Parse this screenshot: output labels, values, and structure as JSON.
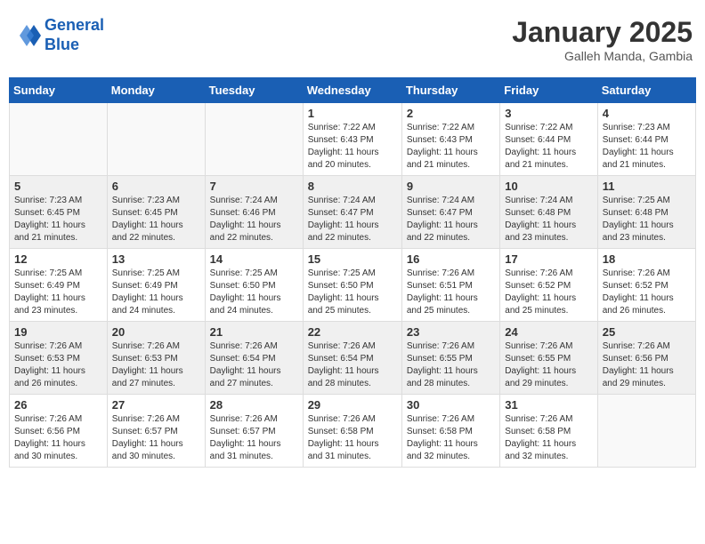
{
  "header": {
    "logo_line1": "General",
    "logo_line2": "Blue",
    "month": "January 2025",
    "location": "Galleh Manda, Gambia"
  },
  "weekdays": [
    "Sunday",
    "Monday",
    "Tuesday",
    "Wednesday",
    "Thursday",
    "Friday",
    "Saturday"
  ],
  "weeks": [
    [
      {
        "day": "",
        "info": ""
      },
      {
        "day": "",
        "info": ""
      },
      {
        "day": "",
        "info": ""
      },
      {
        "day": "1",
        "info": "Sunrise: 7:22 AM\nSunset: 6:43 PM\nDaylight: 11 hours\nand 20 minutes."
      },
      {
        "day": "2",
        "info": "Sunrise: 7:22 AM\nSunset: 6:43 PM\nDaylight: 11 hours\nand 21 minutes."
      },
      {
        "day": "3",
        "info": "Sunrise: 7:22 AM\nSunset: 6:44 PM\nDaylight: 11 hours\nand 21 minutes."
      },
      {
        "day": "4",
        "info": "Sunrise: 7:23 AM\nSunset: 6:44 PM\nDaylight: 11 hours\nand 21 minutes."
      }
    ],
    [
      {
        "day": "5",
        "info": "Sunrise: 7:23 AM\nSunset: 6:45 PM\nDaylight: 11 hours\nand 21 minutes."
      },
      {
        "day": "6",
        "info": "Sunrise: 7:23 AM\nSunset: 6:45 PM\nDaylight: 11 hours\nand 22 minutes."
      },
      {
        "day": "7",
        "info": "Sunrise: 7:24 AM\nSunset: 6:46 PM\nDaylight: 11 hours\nand 22 minutes."
      },
      {
        "day": "8",
        "info": "Sunrise: 7:24 AM\nSunset: 6:47 PM\nDaylight: 11 hours\nand 22 minutes."
      },
      {
        "day": "9",
        "info": "Sunrise: 7:24 AM\nSunset: 6:47 PM\nDaylight: 11 hours\nand 22 minutes."
      },
      {
        "day": "10",
        "info": "Sunrise: 7:24 AM\nSunset: 6:48 PM\nDaylight: 11 hours\nand 23 minutes."
      },
      {
        "day": "11",
        "info": "Sunrise: 7:25 AM\nSunset: 6:48 PM\nDaylight: 11 hours\nand 23 minutes."
      }
    ],
    [
      {
        "day": "12",
        "info": "Sunrise: 7:25 AM\nSunset: 6:49 PM\nDaylight: 11 hours\nand 23 minutes."
      },
      {
        "day": "13",
        "info": "Sunrise: 7:25 AM\nSunset: 6:49 PM\nDaylight: 11 hours\nand 24 minutes."
      },
      {
        "day": "14",
        "info": "Sunrise: 7:25 AM\nSunset: 6:50 PM\nDaylight: 11 hours\nand 24 minutes."
      },
      {
        "day": "15",
        "info": "Sunrise: 7:25 AM\nSunset: 6:50 PM\nDaylight: 11 hours\nand 25 minutes."
      },
      {
        "day": "16",
        "info": "Sunrise: 7:26 AM\nSunset: 6:51 PM\nDaylight: 11 hours\nand 25 minutes."
      },
      {
        "day": "17",
        "info": "Sunrise: 7:26 AM\nSunset: 6:52 PM\nDaylight: 11 hours\nand 25 minutes."
      },
      {
        "day": "18",
        "info": "Sunrise: 7:26 AM\nSunset: 6:52 PM\nDaylight: 11 hours\nand 26 minutes."
      }
    ],
    [
      {
        "day": "19",
        "info": "Sunrise: 7:26 AM\nSunset: 6:53 PM\nDaylight: 11 hours\nand 26 minutes."
      },
      {
        "day": "20",
        "info": "Sunrise: 7:26 AM\nSunset: 6:53 PM\nDaylight: 11 hours\nand 27 minutes."
      },
      {
        "day": "21",
        "info": "Sunrise: 7:26 AM\nSunset: 6:54 PM\nDaylight: 11 hours\nand 27 minutes."
      },
      {
        "day": "22",
        "info": "Sunrise: 7:26 AM\nSunset: 6:54 PM\nDaylight: 11 hours\nand 28 minutes."
      },
      {
        "day": "23",
        "info": "Sunrise: 7:26 AM\nSunset: 6:55 PM\nDaylight: 11 hours\nand 28 minutes."
      },
      {
        "day": "24",
        "info": "Sunrise: 7:26 AM\nSunset: 6:55 PM\nDaylight: 11 hours\nand 29 minutes."
      },
      {
        "day": "25",
        "info": "Sunrise: 7:26 AM\nSunset: 6:56 PM\nDaylight: 11 hours\nand 29 minutes."
      }
    ],
    [
      {
        "day": "26",
        "info": "Sunrise: 7:26 AM\nSunset: 6:56 PM\nDaylight: 11 hours\nand 30 minutes."
      },
      {
        "day": "27",
        "info": "Sunrise: 7:26 AM\nSunset: 6:57 PM\nDaylight: 11 hours\nand 30 minutes."
      },
      {
        "day": "28",
        "info": "Sunrise: 7:26 AM\nSunset: 6:57 PM\nDaylight: 11 hours\nand 31 minutes."
      },
      {
        "day": "29",
        "info": "Sunrise: 7:26 AM\nSunset: 6:58 PM\nDaylight: 11 hours\nand 31 minutes."
      },
      {
        "day": "30",
        "info": "Sunrise: 7:26 AM\nSunset: 6:58 PM\nDaylight: 11 hours\nand 32 minutes."
      },
      {
        "day": "31",
        "info": "Sunrise: 7:26 AM\nSunset: 6:58 PM\nDaylight: 11 hours\nand 32 minutes."
      },
      {
        "day": "",
        "info": ""
      }
    ]
  ]
}
